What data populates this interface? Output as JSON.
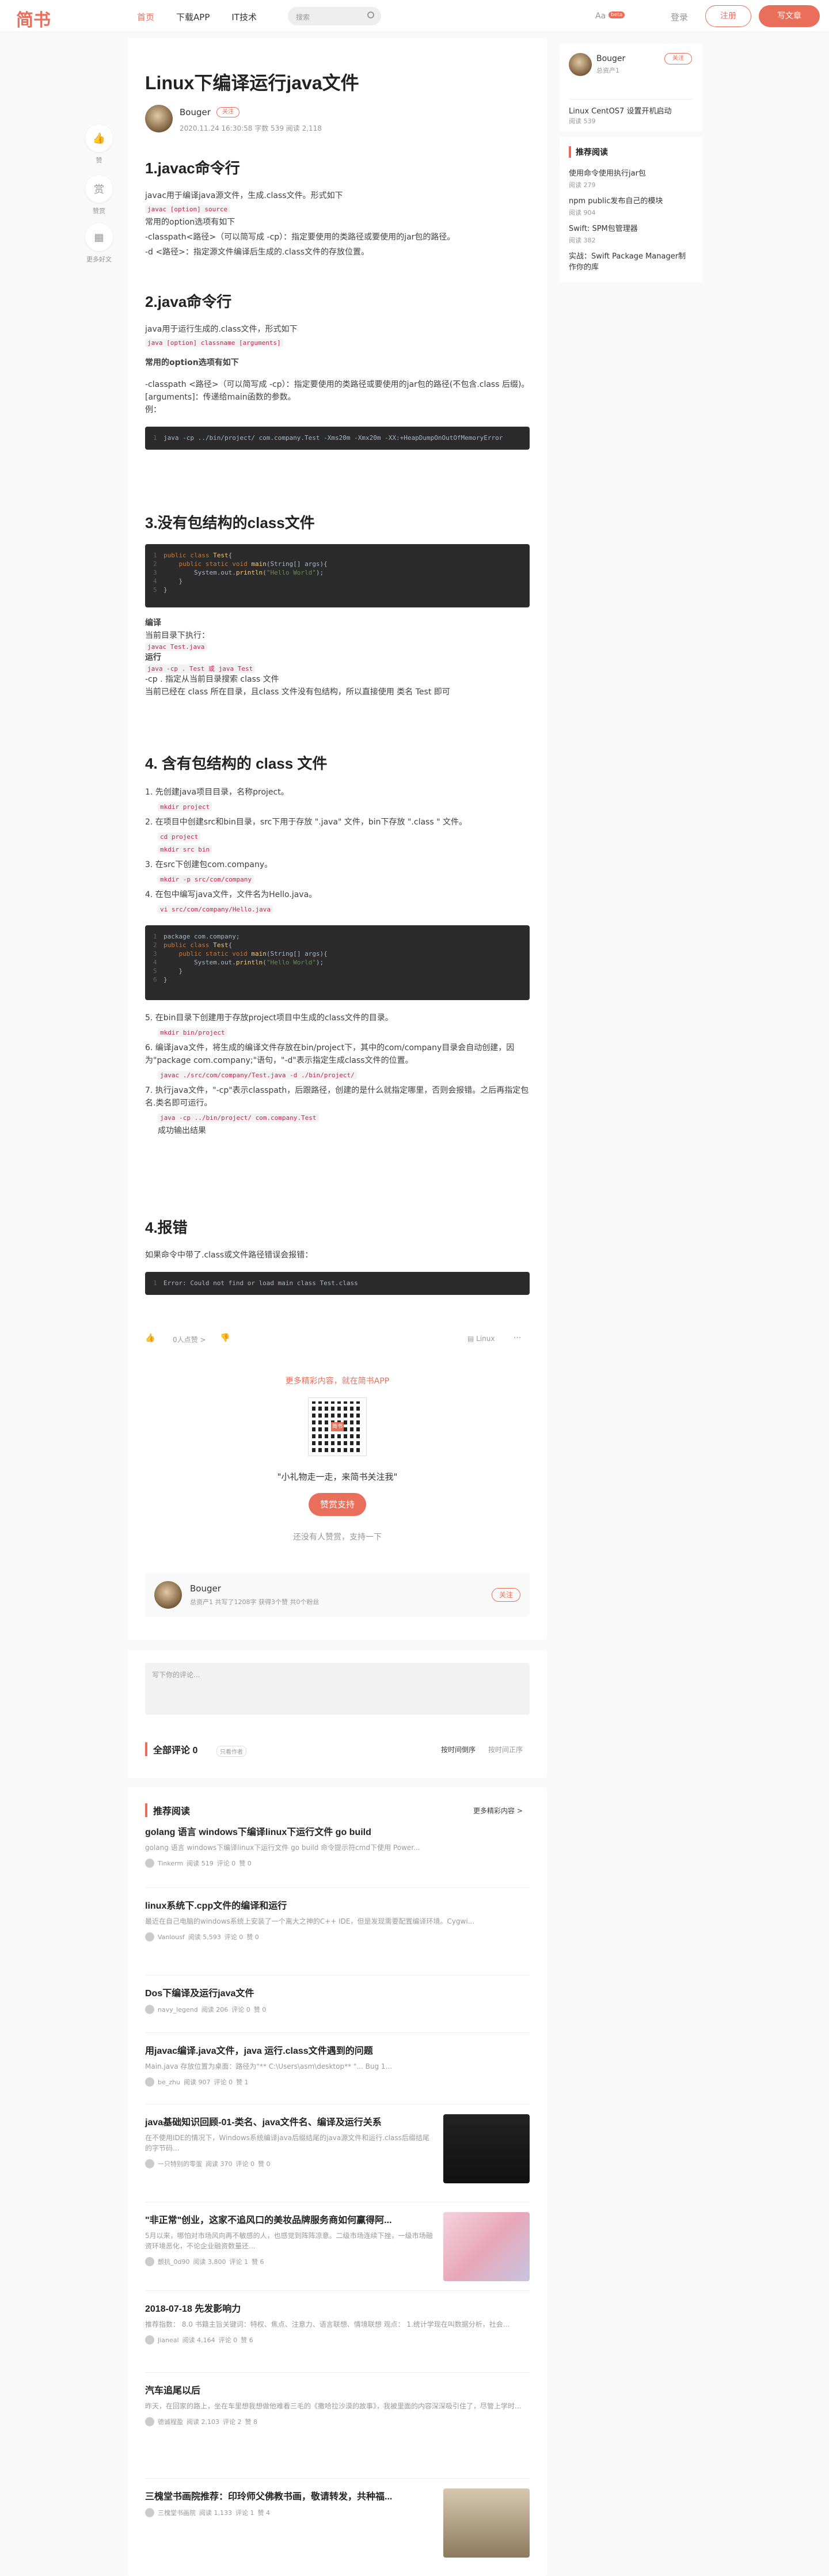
{
  "header": {
    "logo": "简书",
    "nav": [
      "首页",
      "下载APP",
      "IT技术"
    ],
    "search_placeholder": "搜索",
    "aa": "Aa",
    "beta": "beta",
    "login": "登录",
    "register": "注册",
    "write": "写文章"
  },
  "side_actions": [
    {
      "label": "赞",
      "icon": "👍"
    },
    {
      "label": "赞赏",
      "icon": "赏"
    },
    {
      "label": "更多好文",
      "icon": "▦"
    }
  ],
  "article": {
    "title": "Linux下编译运行java文件",
    "author": "Bouger",
    "follow": "关注",
    "meta": "2020.11.24 16:30:58  字数 539  阅读 2,118",
    "s1": {
      "h": "1.javac命令行",
      "p1": "javac用于编译java源文件，生成.class文件。形式如下",
      "c1": "javac [option] source",
      "p2": "常用的option选项有如下",
      "p3": "-classpath<路径>（可以简写成 -cp）：指定要使用的类路径或要使用的jar包的路径。",
      "p4": "-d <路径>：指定源文件编译后生成的.class文件的存放位置。"
    },
    "s2": {
      "h": "2.java命令行",
      "p1": "java用于运行生成的.class文件，形式如下",
      "c1": "java [option] classname [arguments]",
      "h3": "常用的option选项有如下",
      "p2": "-classpath <路径>（可以简写成 -cp）：指定要使用的类路径或要使用的jar包的路径(不包含.class 后缀)。",
      "p3": "[arguments]：传递给main函数的参数。",
      "p4": "例：",
      "code": "java -cp ../bin/project/ com.company.Test -Xms20m -Xmx20m -XX:+HeapDumpOnOutOfMemoryError"
    },
    "s3": {
      "h": "3.没有包结构的class文件",
      "code": [
        "public class Test{",
        "    public static void main(String[] args){",
        "        System.out.println(\"Hello World\");",
        "    }",
        "}"
      ],
      "b1": "编译",
      "p1": "当前目录下执行：",
      "c1": "javac Test.java",
      "b2": "运行",
      "c2": "java -cp . Test 或 java Test",
      "p2": "-cp . 指定从当前目录搜索 class 文件",
      "p3": "当前已经在 class 所在目录，且class 文件没有包结构，所以直接使用 类名 Test 即可"
    },
    "s4": {
      "h": "4. 含有包结构的 class 文件",
      "items": [
        {
          "n": "1.",
          "t": "先创建java项目目录，名称project。",
          "c": [
            "mkdir project"
          ]
        },
        {
          "n": "2.",
          "t": "在项目中创建src和bin目录，src下用于存放 \".java\" 文件，bin下存放 \".class \" 文件。",
          "c": [
            "cd project",
            "mkdir src bin"
          ]
        },
        {
          "n": "3.",
          "t": "在src下创建包com.company。",
          "c": [
            "mkdir -p src/com/company"
          ]
        },
        {
          "n": "4.",
          "t": "在包中编写java文件，文件名为Hello.java。",
          "c": [
            "vi src/com/company/Hello.java"
          ]
        }
      ],
      "code": [
        "package com.company;",
        "public class Test{",
        "    public static void main(String[] args){",
        "        System.out.println(\"Hello World\");",
        "    }",
        "}"
      ],
      "items2": [
        {
          "n": "5.",
          "t": "在bin目录下创建用于存放project项目中生成的class文件的目录。",
          "c": [
            "mkdir bin/project"
          ]
        },
        {
          "n": "6.",
          "t": "编译java文件，将生成的编译文件存放在bin/project下，其中的com/company目录会自动创建，因为\"package com.company;\"语句，\"-d\"表示指定生成class文件的位置。",
          "c": [
            "javac ./src/com/company/Test.java -d ./bin/project/"
          ]
        },
        {
          "n": "7.",
          "t": "执行java文件，\"-cp\"表示classpath，后跟路径，创建的是什么就指定哪里，否则会报错。之后再指定包名.类名即可运行。",
          "c": [
            "java -cp ../bin/project/ com.company.Test"
          ],
          "after": "成功输出结果"
        }
      ]
    },
    "s5": {
      "h": "4.报错",
      "p1": "如果命令中带了.class或文件路径错误会报错：",
      "code": "Error: Could not find or load main class Test.class"
    }
  },
  "actions": {
    "likes": "0人点赞 >",
    "dislike": "👎",
    "collection": "Linux",
    "more": "···"
  },
  "app": {
    "promo": "更多精彩内容，就在简书APP",
    "qr_text": "简书",
    "slogan": "\"小礼物走一走，来简书关注我\"",
    "reward": "赞赏支持",
    "reward_note": "还没有人赞赏，支持一下"
  },
  "author_box": {
    "name": "Bouger",
    "stats": "总资产1  共写了1208字  获得3个赞  共0个粉丝",
    "follow": "关注"
  },
  "comment": {
    "placeholder": "写下你的评论...",
    "title": "全部评论",
    "count": "0",
    "only_author": "只看作者",
    "sort1": "按时间倒序",
    "sort2": "按时间正序"
  },
  "recommend": {
    "title": "推荐阅读",
    "more": "更多精彩内容 >",
    "items": [
      {
        "t": "golang 语言 windows下编译linux下运行文件 go build",
        "d": "golang 语言 windows下编译linux下运行文件 go build 命令提示符cmd下使用 Power...",
        "m": [
          "Tinkerm",
          "阅读 519",
          "评论 0",
          "赞 0"
        ]
      },
      {
        "t": "linux系统下.cpp文件的编译和运行",
        "d": "最近在自己电脑的windows系统上安装了一个离大之神的C++ IDE，但是发现需要配置编译环境。Cygwi...",
        "m": [
          "Vanlousf",
          "阅读 5,593",
          "评论 0",
          "赞 0"
        ]
      },
      {
        "t": "Dos下编译及运行java文件",
        "d": "",
        "m": [
          "navy_legend",
          "阅读 206",
          "评论 0",
          "赞 0"
        ]
      },
      {
        "t": "用javac编译.java文件，java 运行.class文件遇到的问题",
        "d": "Main.java 存放位置为桌面：路径为\"** C:\\Users\\asm\\desktop** \"... Bug 1...",
        "m": [
          "be_zhu",
          "阅读 907",
          "评论 0",
          "赞 1"
        ]
      },
      {
        "t": "java基础知识回顾-01-类名、java文件名、编译及运行关系",
        "d": "在不使用IDE的情况下，Windows系统编译java后缀结尾的java源文件和运行.class后缀结尾的字节码...",
        "m": [
          "一只特别的零蛋",
          "阅读 370",
          "评论 0",
          "赞 0"
        ]
      },
      {
        "t": "\"非正常\"创业，这家不追风口的美妆品牌服务商如何赢得阿...",
        "d": "5月以来，哪怕对市场风向再不敏感的人，也感觉到阵阵凉意。二级市场连续下挫，一级市场融资环境恶化，不论企业融资数量还...",
        "m": [
          "颤抗_0d90",
          "阅读 3,800",
          "评论 1",
          "赞 6"
        ]
      },
      {
        "t": "2018-07-18 先发影响力",
        "d": "推荐指数： 8.0 书籍主旨关键词：特权、焦点、注意力、语言联想、情境联想 观点： 1.统计学现在叫数据分析，社会...",
        "m": [
          "Jianeal",
          "阅读 4,164",
          "评论 0",
          "赞 6"
        ]
      },
      {
        "t": "汽车追尾以后",
        "d": "昨天，在回家的路上，坐在车里想我想做他难看三毛的《撒哈拉沙漠的故事》，我被里面的内容深深吸引住了，尽管上学时...",
        "m": [
          "德诚程盈",
          "阅读 2,103",
          "评论 2",
          "赞 8"
        ]
      },
      {
        "t": "三槐堂书画院推荐：印玲师父佛教书画，敬请转发，共种福...",
        "d": "",
        "m": [
          "三槐堂书画院",
          "阅读 1,133",
          "评论 1",
          "赞 4"
        ]
      }
    ]
  },
  "right": {
    "author": "Bouger",
    "assets": "总资产1",
    "follow": "关注",
    "post": "Linux CentOS7 设置开机启动",
    "post_reads": "阅读 539",
    "rec_title": "推荐阅读",
    "rec": [
      {
        "t": "使用命令使用执行jar包",
        "r": "阅读 279"
      },
      {
        "t": "npm public发布自己的模块",
        "r": "阅读 904"
      },
      {
        "t": "Swift: SPM包管理器",
        "r": "阅读 382"
      },
      {
        "t": "实战：Swift Package Manager制作你的库",
        "r": ""
      }
    ]
  }
}
